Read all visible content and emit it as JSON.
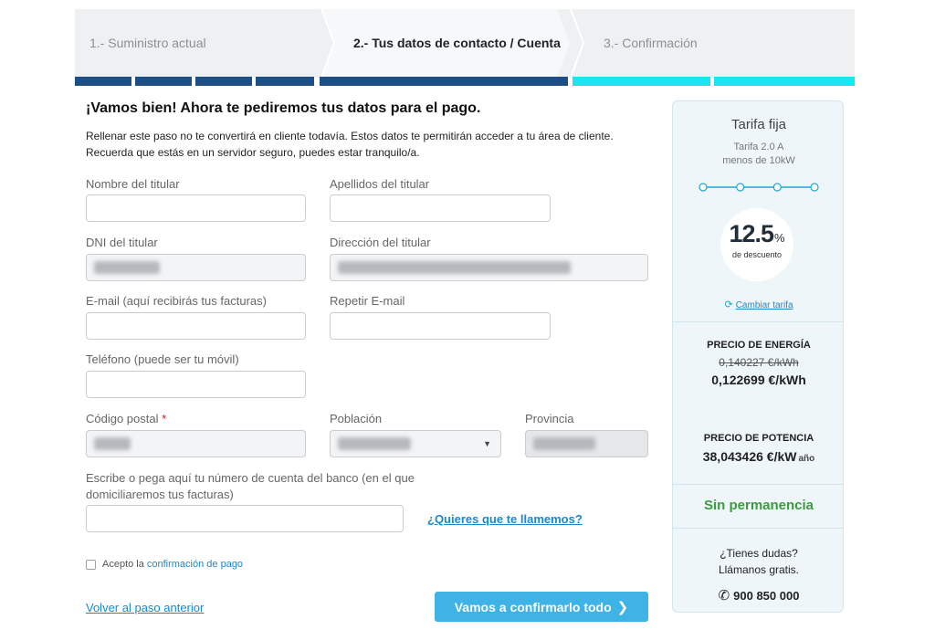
{
  "steps": [
    {
      "label": "1.- Suministro actual"
    },
    {
      "label": "2.- Tus datos de contacto / Cuenta"
    },
    {
      "label": "3.- Confirmación"
    }
  ],
  "colors": {
    "progress_done": "#1b4f86",
    "progress_pending": "#19e6f2",
    "accent_blue": "#1d87c9",
    "button_blue": "#3fb2e6",
    "green": "#3d9a3f"
  },
  "form": {
    "title": "¡Vamos bien! Ahora te pediremos tus datos para el pago.",
    "intro": "Rellenar este paso no te convertirá en cliente todavía. Estos datos te permitirán acceder a tu área de cliente. Recuerda que estás en un servidor seguro, puedes estar tranquilo/a.",
    "fields": {
      "nombre": {
        "label": "Nombre del titular",
        "value": ""
      },
      "apellidos": {
        "label": "Apellidos del titular",
        "value": ""
      },
      "dni": {
        "label": "DNI del titular"
      },
      "direccion": {
        "label": "Dirección del titular"
      },
      "email": {
        "label": "E-mail (aquí recibirás tus facturas)",
        "value": ""
      },
      "email_repeat": {
        "label": "Repetir E-mail",
        "value": ""
      },
      "telefono": {
        "label": "Teléfono (puede ser tu móvil)",
        "value": ""
      },
      "codigo_postal": {
        "label": "Código postal",
        "required_mark": "*"
      },
      "poblacion": {
        "label": "Población"
      },
      "provincia": {
        "label": "Provincia"
      },
      "cuenta": {
        "label": "Escribe o pega aquí tu número de cuenta del banco (en el que domiciliaremos tus facturas)",
        "value": ""
      }
    },
    "call_link": "¿Quieres que te llamemos?",
    "accept_prefix": "Acepto la",
    "accept_link": "confirmación de pago",
    "accept_checked": false,
    "back_link": "Volver al paso anterior",
    "submit_label": "Vamos a confirmarlo todo",
    "submit_chevron": "❯"
  },
  "sidebar": {
    "plan_title": "Tarifa fija",
    "plan_sub1": "Tarifa 2.0 A",
    "plan_sub2": "menos de 10kW",
    "discount_value": "12.5",
    "discount_unit": "%",
    "discount_label": "de descuento",
    "change_label": "Cambiar tarifa",
    "change_icon": "refresh-icon",
    "energy_heading": "PRECIO DE ENERGÍA",
    "energy_old": "0,140227 €/kWh",
    "energy_new": "0,122699 €/kWh",
    "power_heading": "PRECIO DE POTENCIA",
    "power_value": "38,043426 €/kW",
    "power_unit": "año",
    "permanence": "Sin permanencia",
    "help_line1": "¿Tienes dudas?",
    "help_line2": "Llámanos gratis.",
    "phone_icon": "phone-icon",
    "phone": "900 850 000"
  }
}
